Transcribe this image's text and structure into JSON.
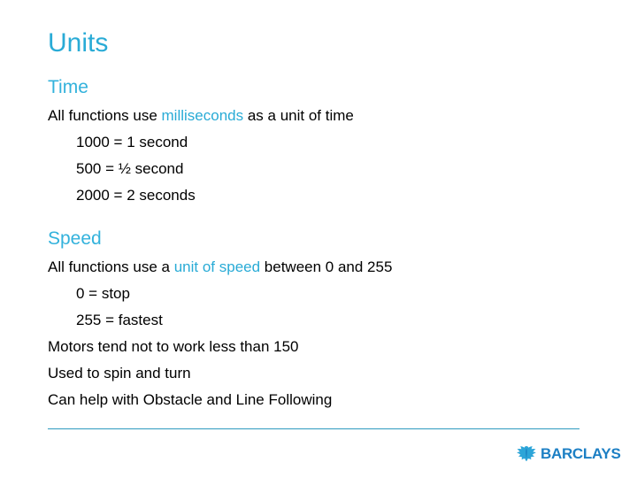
{
  "slide": {
    "title": "Units",
    "sections": [
      {
        "heading": "Time",
        "lines": [
          {
            "text": "All functions use milliseconds as a unit of time",
            "highlight": "milliseconds",
            "indent": false
          },
          {
            "text": "1000 = 1 second",
            "indent": true
          },
          {
            "text": "500 = ½ second",
            "indent": true
          },
          {
            "text": "2000 = 2 seconds",
            "indent": true
          }
        ]
      },
      {
        "heading": "Speed",
        "lines": [
          {
            "text": "All functions use a unit of speed between 0 and 255",
            "highlight": "unit of speed",
            "indent": false
          },
          {
            "text": "0 = stop",
            "indent": true
          },
          {
            "text": "255 = fastest",
            "indent": true
          },
          {
            "text": "Motors tend not to work less than 150",
            "indent": false
          },
          {
            "text": "Used to spin and turn",
            "indent": false
          },
          {
            "text": "Can help with Obstacle and Line Following",
            "indent": false
          }
        ]
      }
    ]
  },
  "footer": {
    "logo_name": "barclays-eagle-icon",
    "brand": "BARCLAYS"
  },
  "colors": {
    "accent": "#29ABD6",
    "heading": "#33B2DC",
    "divider": "#2E9BBF",
    "brand_blue": "#1C7FC4",
    "text": "#000000"
  }
}
